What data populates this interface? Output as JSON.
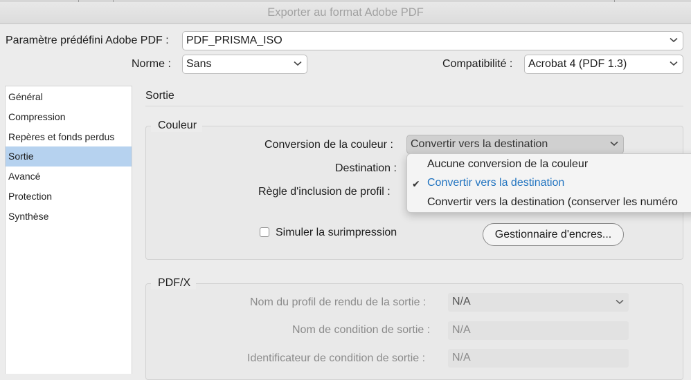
{
  "window": {
    "title": "Exporter au format Adobe PDF"
  },
  "preset": {
    "label": "Paramètre prédéfini Adobe PDF :",
    "value": "PDF_PRISMA_ISO"
  },
  "standard": {
    "label": "Norme  :",
    "value": "Sans"
  },
  "compat": {
    "label": "Compatibilité :",
    "value": "Acrobat 4 (PDF 1.3)"
  },
  "sidebar": {
    "items": [
      {
        "label": "Général",
        "selected": false
      },
      {
        "label": "Compression",
        "selected": false
      },
      {
        "label": "Repères et fonds perdus",
        "selected": false
      },
      {
        "label": "Sortie",
        "selected": true
      },
      {
        "label": "Avancé",
        "selected": false
      },
      {
        "label": "Protection",
        "selected": false
      },
      {
        "label": "Synthèse",
        "selected": false
      }
    ]
  },
  "section": {
    "title": "Sortie"
  },
  "color": {
    "legend": "Couleur",
    "conversion_label": "Conversion de la couleur :",
    "conversion_value": "Convertir vers la destination",
    "destination_label": "Destination :",
    "profile_rule_label": "Règle d'inclusion de profil :",
    "simulate_label": "Simuler la surimpression",
    "simulate_checked": false,
    "ink_manager_button": "Gestionnaire d'encres..."
  },
  "conversion_menu": {
    "options": [
      "Aucune conversion de la couleur",
      "Convertir vers la destination",
      "Convertir vers la destination (conserver les numéro"
    ],
    "selected_index": 1
  },
  "pdfx": {
    "legend": "PDF/X",
    "profile_label": "Nom du profil de rendu de la sortie :",
    "profile_value": "N/A",
    "condition_label": "Nom de condition de sortie :",
    "condition_value": "N/A",
    "identifier_label": "Identificateur de condition de sortie :",
    "identifier_value": "N/A"
  },
  "colors": {
    "selection": "#b6d2ef",
    "menu_highlight": "#2274c0"
  }
}
